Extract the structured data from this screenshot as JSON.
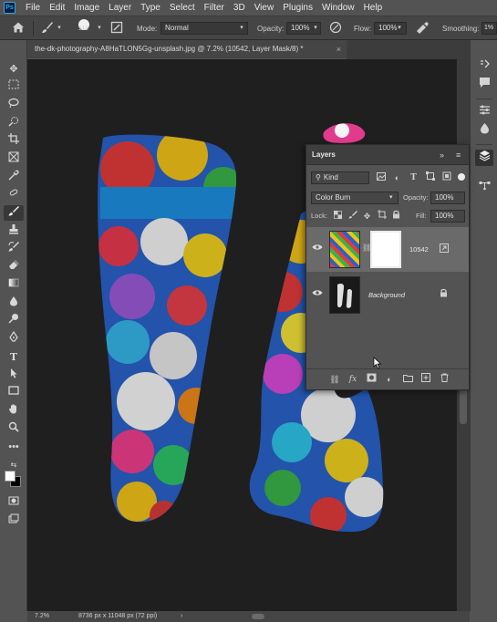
{
  "menubar": {
    "logo": "Ps",
    "items": [
      "File",
      "Edit",
      "Image",
      "Layer",
      "Type",
      "Select",
      "Filter",
      "3D",
      "View",
      "Plugins",
      "Window",
      "Help"
    ]
  },
  "options": {
    "brush_size": "313",
    "mode_label": "Mode:",
    "mode_value": "Normal",
    "opacity_label": "Opacity:",
    "opacity_value": "100%",
    "flow_label": "Flow:",
    "flow_value": "100%",
    "smoothing_label": "Smoothing:",
    "smoothing_value": "1%"
  },
  "document": {
    "tab_title": "the-dk-photography-A8HaTLON5Gg-unsplash.jpg @ 7.2% (10542, Layer Mask/8) *",
    "close_glyph": "×"
  },
  "status": {
    "zoom": "7.2%",
    "dimensions": "8736 px x 11048 px (72 ppi)",
    "arrow": "›"
  },
  "layers_panel": {
    "title": "Layers",
    "collapse_glyph": "»",
    "menu_glyph": "≡",
    "filter_kind": "Kind",
    "blend_mode": "Color Burn",
    "opacity_label": "Opacity:",
    "opacity_value": "100%",
    "lock_label": "Lock:",
    "fill_label": "Fill:",
    "fill_value": "100%",
    "layers": [
      {
        "name": "10542",
        "selected": true
      },
      {
        "name": "Background",
        "selected": false
      }
    ]
  },
  "colors": {
    "accent": "#31a8ff",
    "ui_dark": "#535353",
    "canvas": "#1f1f1f",
    "selected_layer": "#6a6a6a"
  }
}
